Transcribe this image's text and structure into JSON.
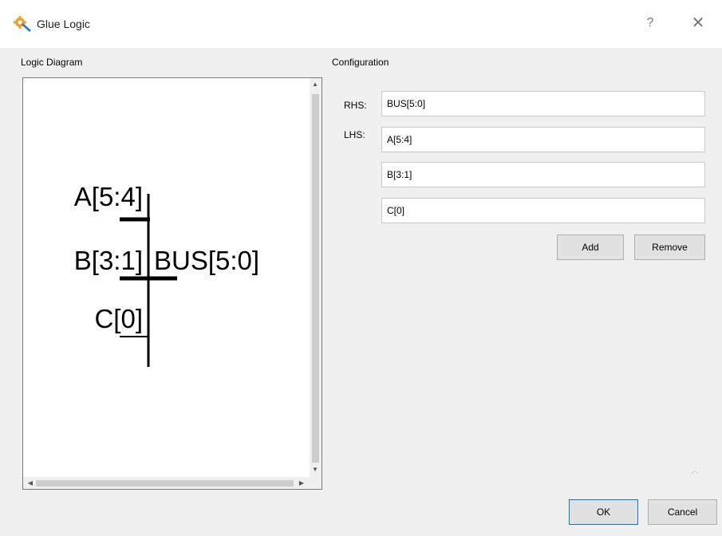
{
  "window": {
    "title": "Glue Logic",
    "help_glyph": "?",
    "close_glyph": "✕",
    "icon": "gear-wrench-icon"
  },
  "diagram_panel": {
    "heading": "Logic Diagram",
    "inputs": [
      "A[5:4]",
      "B[3:1]",
      "C[0]"
    ],
    "output": "BUS[5:0]"
  },
  "config": {
    "heading": "Configuration",
    "rhs_label": "RHS:",
    "lhs_label": "LHS:",
    "rhs_value": "BUS[5:0]",
    "lhs_values": [
      "A[5:4]",
      "B[3:1]",
      "C[0]"
    ],
    "add_label": "Add",
    "remove_label": "Remove"
  },
  "footer": {
    "ok_label": "OK",
    "cancel_label": "Cancel"
  },
  "colors": {
    "accent": "#0078d7",
    "icon_orange": "#f0a030",
    "icon_blue": "#2a7bd6"
  }
}
